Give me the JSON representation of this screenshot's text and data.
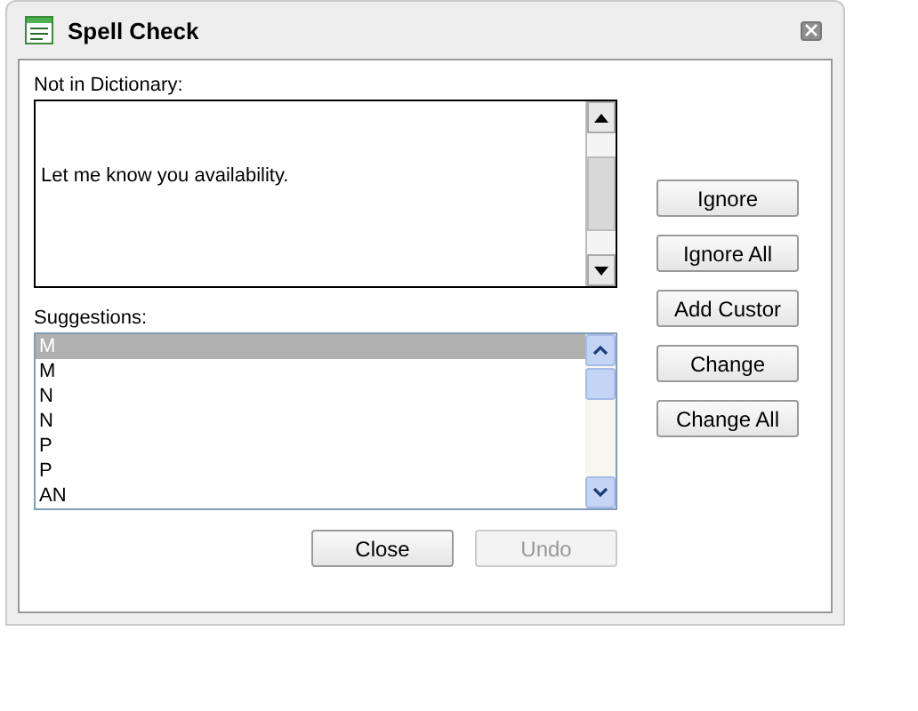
{
  "window": {
    "title": "Spell Check"
  },
  "not_in_dictionary": {
    "label": "Not in Dictionary:",
    "text": "Let me know you availability."
  },
  "suggestions": {
    "label": "Suggestions:",
    "items": [
      {
        "text": "M",
        "selected": true
      },
      {
        "text": "M",
        "selected": false
      },
      {
        "text": "N",
        "selected": false
      },
      {
        "text": "N",
        "selected": false
      },
      {
        "text": "P",
        "selected": false
      },
      {
        "text": "P",
        "selected": false
      },
      {
        "text": "AN",
        "selected": false
      }
    ]
  },
  "side_buttons": [
    {
      "label": "Ignore",
      "disabled": false
    },
    {
      "label": "Ignore All",
      "disabled": false
    },
    {
      "label": "Add Custor",
      "disabled": false
    },
    {
      "label": "Change",
      "disabled": false
    },
    {
      "label": "Change All",
      "disabled": false
    }
  ],
  "bottom_buttons": [
    {
      "label": "Close",
      "disabled": false
    },
    {
      "label": "Undo",
      "disabled": true
    }
  ]
}
